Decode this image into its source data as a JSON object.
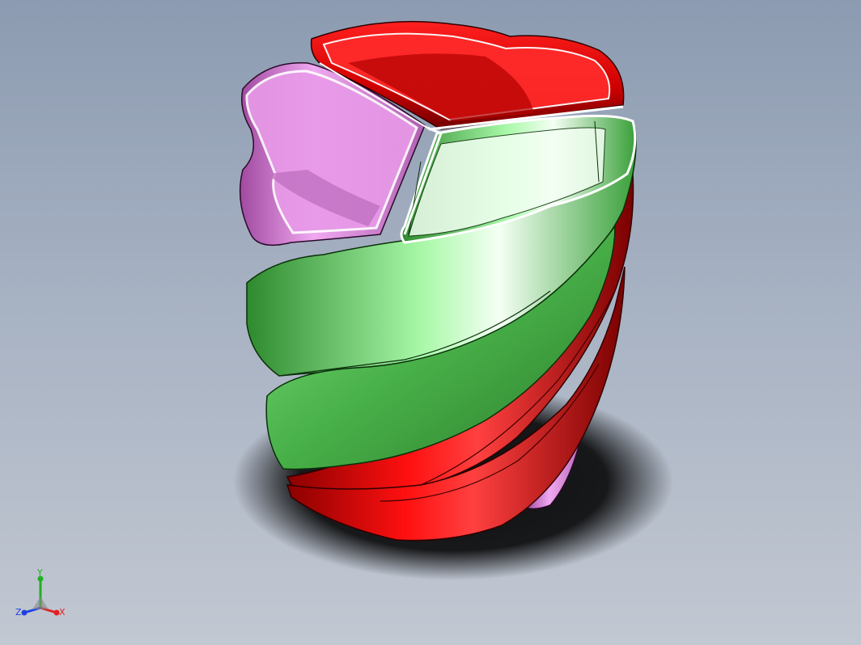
{
  "viewport": {
    "background_top": "#8c9bb1",
    "background_bottom": "#c2c8d2"
  },
  "model": {
    "part_colors": {
      "segment_a": "#e00000",
      "segment_b": "#88ee88",
      "segment_c": "#e98ae9"
    }
  },
  "triad": {
    "x_label": "X",
    "y_label": "Y",
    "z_label": "Z",
    "x_color": "#e02020",
    "y_color": "#20b020",
    "z_color": "#2040e0"
  }
}
